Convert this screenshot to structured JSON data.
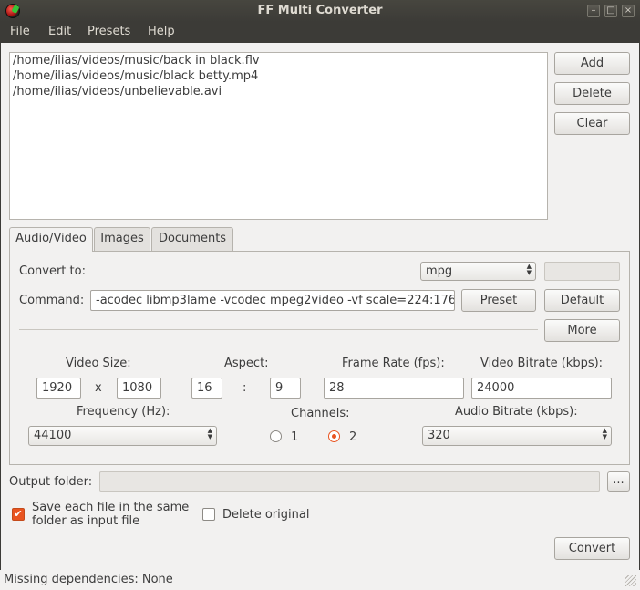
{
  "window": {
    "title": "FF Multi Converter",
    "controls": {
      "minimize": "–",
      "maximize": "□",
      "close": "×"
    }
  },
  "menubar": {
    "items": [
      "File",
      "Edit",
      "Presets",
      "Help"
    ]
  },
  "files": [
    "/home/ilias/videos/music/back in black.flv",
    "/home/ilias/videos/music/black betty.mp4",
    "/home/ilias/videos/unbelievable.avi"
  ],
  "side_buttons": {
    "add": "Add",
    "delete": "Delete",
    "clear": "Clear"
  },
  "tabs": [
    "Audio/Video",
    "Images",
    "Documents"
  ],
  "active_tab": "Audio/Video",
  "audio_video": {
    "convert_to_label": "Convert to:",
    "format": "mpg",
    "command_label": "Command:",
    "command_value": "-acodec libmp3lame -vcodec mpeg2video -vf scale=224:176",
    "preset_button": "Preset",
    "default_button": "Default",
    "more_button": "More",
    "video_size_label": "Video Size:",
    "width": "1920",
    "x_sep": "x",
    "height": "1080",
    "aspect_label": "Aspect:",
    "aspect_w": "16",
    "aspect_sep": ":",
    "aspect_h": "9",
    "frame_rate_label": "Frame Rate (fps):",
    "frame_rate": "28",
    "video_bitrate_label": "Video Bitrate (kbps):",
    "video_bitrate": "24000",
    "frequency_label": "Frequency (Hz):",
    "frequency": "44100",
    "channels_label": "Channels:",
    "channel_options": [
      "1",
      "2"
    ],
    "channel_selected": "2",
    "audio_bitrate_label": "Audio Bitrate (kbps):",
    "audio_bitrate": "320"
  },
  "output": {
    "label": "Output folder:",
    "value": "",
    "browse": "..."
  },
  "options": {
    "save_same_folder": "Save each file in the same\nfolder as input file",
    "save_same_folder_checked": true,
    "delete_original": "Delete original",
    "delete_original_checked": false
  },
  "convert_button": "Convert",
  "status": "Missing dependencies: None",
  "colors": {
    "accent": "#e95420",
    "titlebar": "#3c3b37",
    "window_bg": "#f2f1f0"
  }
}
